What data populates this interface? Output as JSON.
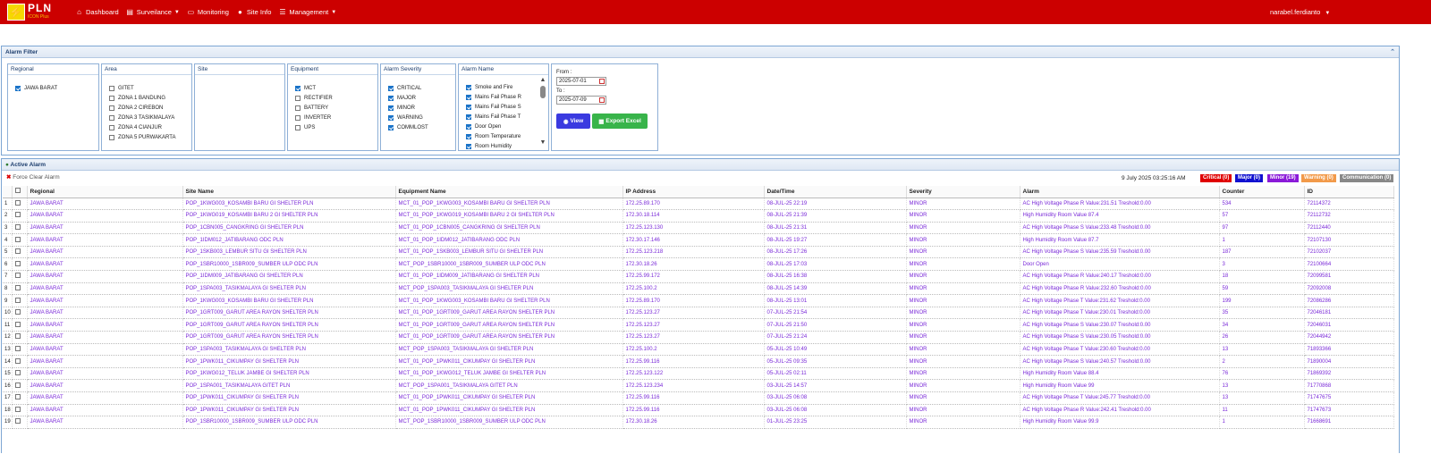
{
  "app": {
    "logo_letter": "⚡",
    "brand": "PLN",
    "brand_sub": "ICON Plus"
  },
  "nav": {
    "dashboard": "Dashboard",
    "surveilance": "Surveilance",
    "monitoring": "Monitoring",
    "site_info": "Site Info",
    "management": "Management",
    "user": "narabel.ferdianto"
  },
  "filter": {
    "title": "Alarm Filter",
    "regional": {
      "label": "Regional",
      "options": [
        {
          "label": "JAWA BARAT",
          "checked": true
        }
      ]
    },
    "area": {
      "label": "Area",
      "options": [
        {
          "label": "GITET",
          "checked": false
        },
        {
          "label": "ZONA 1 BANDUNG",
          "checked": false
        },
        {
          "label": "ZONA 2 CIREBON",
          "checked": false
        },
        {
          "label": "ZONA 3 TASIKMALAYA",
          "checked": false
        },
        {
          "label": "ZONA 4 CIANJUR",
          "checked": false
        },
        {
          "label": "ZONA 5 PURWAKARTA",
          "checked": false
        }
      ]
    },
    "site": {
      "label": "Site"
    },
    "equipment": {
      "label": "Equipment",
      "options": [
        {
          "label": "MCT",
          "checked": true
        },
        {
          "label": "RECTIFIER",
          "checked": false
        },
        {
          "label": "BATTERY",
          "checked": false
        },
        {
          "label": "INVERTER",
          "checked": false
        },
        {
          "label": "UPS",
          "checked": false
        }
      ]
    },
    "severity": {
      "label": "Alarm Severity",
      "options": [
        {
          "label": "CRITICAL",
          "checked": true
        },
        {
          "label": "MAJOR",
          "checked": true
        },
        {
          "label": "MINOR",
          "checked": true
        },
        {
          "label": "WARNING",
          "checked": true
        },
        {
          "label": "COMMLOST",
          "checked": true
        }
      ]
    },
    "alarm_name": {
      "label": "Alarm Name",
      "options": [
        {
          "label": "Smoke and Fire",
          "checked": true
        },
        {
          "label": "Mains Fail Phase R",
          "checked": true
        },
        {
          "label": "Mains Fail Phase S",
          "checked": true
        },
        {
          "label": "Mains Fail Phase T",
          "checked": true
        },
        {
          "label": "Door Open",
          "checked": true
        },
        {
          "label": "Room Temperature",
          "checked": true
        },
        {
          "label": "Room Humidity",
          "checked": true
        }
      ]
    },
    "from_label": "From :",
    "from_value": "2025-07-01",
    "to_label": "To :",
    "to_value": "2025-07-09",
    "view_label": "View",
    "export_label": "Export Excel"
  },
  "active": {
    "title": "Active Alarm",
    "force_clear": "Force Clear Alarm",
    "timestamp": "9 July 2025 03:25:16 AM",
    "badges": {
      "critical": "Critical (0)",
      "major": "Major (0)",
      "minor": "Minor (19)",
      "warning": "Warning (0)",
      "communication": "Communication (0)"
    },
    "colors": {
      "critical": "#e00000",
      "major": "#1010d0",
      "minor": "#8a1ad8",
      "warning": "#f29a4a",
      "communication": "#888888"
    },
    "columns": [
      "Regional",
      "Site Name",
      "Equipment Name",
      "IP Address",
      "Date/Time",
      "Severity",
      "Alarm",
      "Counter",
      "ID"
    ],
    "rows": [
      [
        "1",
        "JAWA BARAT",
        "POP_1KWG003_KOSAMBI BARU GI SHELTER PLN",
        "MCT_01_POP_1KWG003_KOSAMBI BARU GI SHELTER PLN",
        "172.25.89.170",
        "08-JUL-25 22:19",
        "MINOR",
        "AC High Voltage Phase R Value:231.51 Treshold:0.00",
        "534",
        "72114372"
      ],
      [
        "2",
        "JAWA BARAT",
        "POP_1KWG019_KOSAMBI BARU 2 GI SHELTER PLN",
        "MCT_01_POP_1KWG019_KOSAMBI BARU 2 GI SHELTER PLN",
        "172.30.18.114",
        "08-JUL-25 21:39",
        "MINOR",
        "High Humidity Room Value 87.4",
        "57",
        "72112732"
      ],
      [
        "3",
        "JAWA BARAT",
        "POP_1CBN005_CANGKRING GI SHELTER PLN",
        "MCT_01_POP_1CBN005_CANGKRING GI SHELTER PLN",
        "172.25.123.130",
        "08-JUL-25 21:31",
        "MINOR",
        "AC High Voltage Phase S Value:233.48 Treshold:0.00",
        "97",
        "72112440"
      ],
      [
        "4",
        "JAWA BARAT",
        "POP_1IDM012_JATIBARANG ODC PLN",
        "MCT_01_POP_1IDM012_JATIBARANG ODC PLN",
        "172.30.17.146",
        "08-JUL-25 19:27",
        "MINOR",
        "High Humidity Room Value 87.7",
        "1",
        "72107130"
      ],
      [
        "5",
        "JAWA BARAT",
        "POP_1SKB003_LEMBUR SITU GI SHELTER PLN",
        "MCT_01_POP_1SKB003_LEMBUR SITU GI SHELTER PLN",
        "172.25.123.218",
        "08-JUL-25 17:26",
        "MINOR",
        "AC High Voltage Phase S Value:235.59 Treshold:0.00",
        "187",
        "72102037"
      ],
      [
        "6",
        "JAWA BARAT",
        "POP_1SBR10000_1SBR009_SUMBER ULP ODC PLN",
        "MCT_POP_1SBR10000_1SBR009_SUMBER ULP ODC PLN",
        "172.30.18.26",
        "08-JUL-25 17:03",
        "MINOR",
        "Door Open",
        "3",
        "72100664"
      ],
      [
        "7",
        "JAWA BARAT",
        "POP_1IDM009_JATIBARANG GI SHELTER PLN",
        "MCT_01_POP_1IDM009_JATIBARANG GI SHELTER PLN",
        "172.25.99.172",
        "08-JUL-25 16:38",
        "MINOR",
        "AC High Voltage Phase R Value:240.17 Treshold:0.00",
        "18",
        "72099581"
      ],
      [
        "8",
        "JAWA BARAT",
        "POP_1SPA003_TASIKMALAYA GI SHELTER PLN",
        "MCT_POP_1SPA003_TASIKMALAYA GI SHELTER PLN",
        "172.25.100.2",
        "08-JUL-25 14:39",
        "MINOR",
        "AC High Voltage Phase R Value:232.60 Treshold:0.00",
        "59",
        "72092008"
      ],
      [
        "9",
        "JAWA BARAT",
        "POP_1KWG003_KOSAMBI BARU GI SHELTER PLN",
        "MCT_01_POP_1KWG003_KOSAMBI BARU GI SHELTER PLN",
        "172.25.89.170",
        "08-JUL-25 13:01",
        "MINOR",
        "AC High Voltage Phase T Value:231.62 Treshold:0.00",
        "199",
        "72086286"
      ],
      [
        "10",
        "JAWA BARAT",
        "POP_1GRT009_GARUT AREA RAYON SHELTER PLN",
        "MCT_01_POP_1GRT009_GARUT AREA RAYON SHELTER PLN",
        "172.25.123.27",
        "07-JUL-25 21:54",
        "MINOR",
        "AC High Voltage Phase T Value:230.01 Treshold:0.00",
        "35",
        "72046181"
      ],
      [
        "11",
        "JAWA BARAT",
        "POP_1GRT009_GARUT AREA RAYON SHELTER PLN",
        "MCT_01_POP_1GRT009_GARUT AREA RAYON SHELTER PLN",
        "172.25.123.27",
        "07-JUL-25 21:50",
        "MINOR",
        "AC High Voltage Phase S Value:230.07 Treshold:0.00",
        "34",
        "72046031"
      ],
      [
        "12",
        "JAWA BARAT",
        "POP_1GRT009_GARUT AREA RAYON SHELTER PLN",
        "MCT_01_POP_1GRT009_GARUT AREA RAYON SHELTER PLN",
        "172.25.123.27",
        "07-JUL-25 21:24",
        "MINOR",
        "AC High Voltage Phase S Value:230.05 Treshold:0.00",
        "26",
        "72044942"
      ],
      [
        "13",
        "JAWA BARAT",
        "POP_1SPA003_TASIKMALAYA GI SHELTER PLN",
        "MCT_POP_1SPA003_TASIKMALAYA GI SHELTER PLN",
        "172.25.100.2",
        "05-JUL-25 10:49",
        "MINOR",
        "AC High Voltage Phase T Value:230.60 Treshold:0.00",
        "13",
        "71893366"
      ],
      [
        "14",
        "JAWA BARAT",
        "POP_1PWK011_CIKUMPAY GI SHELTER PLN",
        "MCT_01_POP_1PWK011_CIKUMPAY GI SHELTER PLN",
        "172.25.99.116",
        "05-JUL-25 09:35",
        "MINOR",
        "AC High Voltage Phase S Value:240.57 Treshold:0.00",
        "2",
        "71890004"
      ],
      [
        "15",
        "JAWA BARAT",
        "POP_1KWG012_TELUK JAMBE GI SHELTER PLN",
        "MCT_01_POP_1KWG012_TELUK JAMBE GI SHELTER PLN",
        "172.25.123.122",
        "05-JUL-25 02:11",
        "MINOR",
        "High Humidity Room Value 88.4",
        "76",
        "71869392"
      ],
      [
        "16",
        "JAWA BARAT",
        "POP_1SPA001_TASIKMALAYA GITET PLN",
        "MCT_POP_1SPA001_TASIKMALAYA GITET PLN",
        "172.25.123.234",
        "03-JUL-25 14:57",
        "MINOR",
        "High Humidity Room Value 99",
        "13",
        "71770868"
      ],
      [
        "17",
        "JAWA BARAT",
        "POP_1PWK011_CIKUMPAY GI SHELTER PLN",
        "MCT_01_POP_1PWK011_CIKUMPAY GI SHELTER PLN",
        "172.25.99.116",
        "03-JUL-25 06:08",
        "MINOR",
        "AC High Voltage Phase T Value:245.77 Treshold:0.00",
        "13",
        "71747675"
      ],
      [
        "18",
        "JAWA BARAT",
        "POP_1PWK011_CIKUMPAY GI SHELTER PLN",
        "MCT_01_POP_1PWK011_CIKUMPAY GI SHELTER PLN",
        "172.25.99.116",
        "03-JUL-25 06:08",
        "MINOR",
        "AC High Voltage Phase R Value:242.41 Treshold:0.00",
        "11",
        "71747673"
      ],
      [
        "19",
        "JAWA BARAT",
        "POP_1SBR10000_1SBR009_SUMBER ULP ODC PLN",
        "MCT_POP_1SBR10000_1SBR009_SUMBER ULP ODC PLN",
        "172.30.18.26",
        "01-JUL-25 23:25",
        "MINOR",
        "High Humidity Room Value 99.9",
        "1",
        "71668691"
      ]
    ]
  }
}
